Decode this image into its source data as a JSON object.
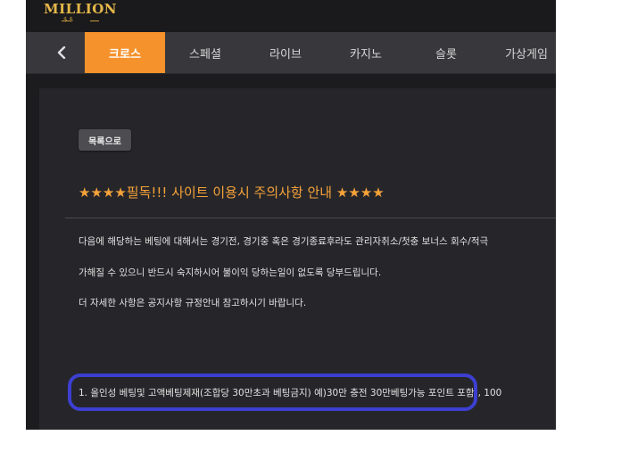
{
  "brand": {
    "name": "MILLION",
    "sub": "$ $"
  },
  "nav": {
    "tabs": [
      {
        "label": "크로스",
        "active": true
      },
      {
        "label": "스페셜",
        "active": false
      },
      {
        "label": "라이브",
        "active": false
      },
      {
        "label": "카지노",
        "active": false
      },
      {
        "label": "슬롯",
        "active": false
      },
      {
        "label": "가상게임",
        "active": false
      }
    ],
    "back_icon": "chevron-left-icon"
  },
  "post": {
    "back_button": "목록으로",
    "title": "★★★★필독!!! 사이트 이용시 주의사항 안내 ★★★★",
    "lines": [
      "다음에 해당하는 베팅에 대해서는 경기전, 경기중 혹은 경기종료후라도 관리자취소/첫충 보너스 회수/적극",
      "가해질 수 있으니 반드시 숙지하시어 불이익 당하는일이 없도록 당부드립니다.",
      "더 자세한 사항은 공지사항 규정안내 참고하시기 바랍니다.",
      "1. 올인성 베팅및 고액베팅제재(조합당 30만초과 베팅금지) 예)30만 충전 30만베팅가능 포인트 포함), 100"
    ]
  },
  "colors": {
    "accent": "#f5922c",
    "title": "#f5a23a",
    "annotation": "#3c3fd0"
  }
}
